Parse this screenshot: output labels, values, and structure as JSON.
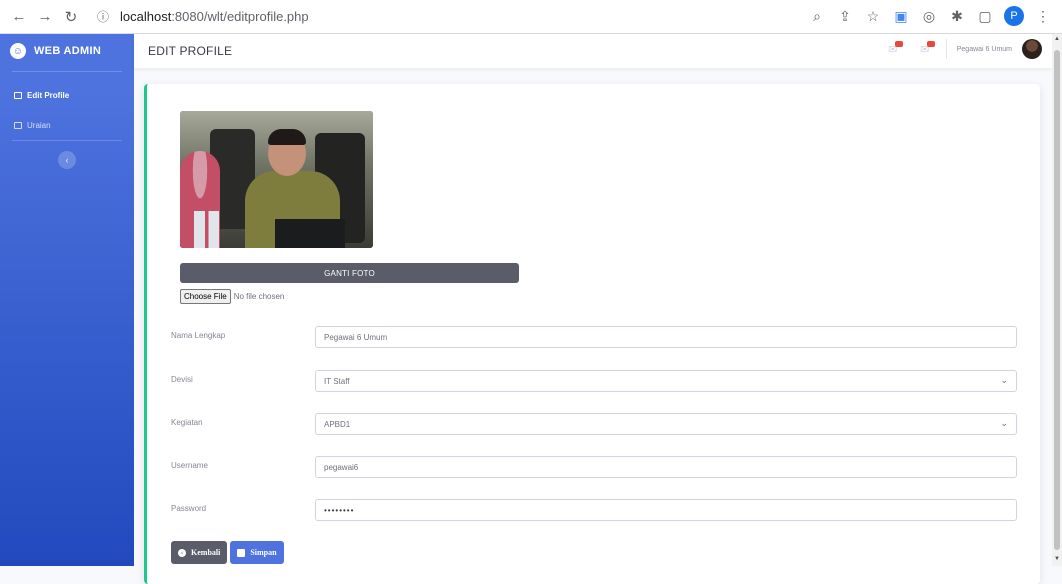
{
  "browser": {
    "url_host": "localhost",
    "url_path": ":8080/wlt/editprofile.php",
    "profile_initial": "P"
  },
  "sidebar": {
    "brand": "WEB ADMIN",
    "items": [
      {
        "label": "Edit Profile",
        "active": true
      },
      {
        "label": "Uraian",
        "active": false
      }
    ],
    "toggle_icon": "chevron-left-icon"
  },
  "topbar": {
    "title": "EDIT PROFILE",
    "user_name": "Pegawai 6 Umum"
  },
  "profile": {
    "change_photo_label": "GANTI FOTO",
    "choose_file_label": "Choose File",
    "file_status": "No file chosen",
    "fields": {
      "nama": {
        "label": "Nama Lengkap",
        "value": "Pegawai 6 Umum"
      },
      "devisi": {
        "label": "Devisi",
        "value": "IT Staff"
      },
      "kegiatan": {
        "label": "Kegiatan",
        "value": "APBD1"
      },
      "username": {
        "label": "Username",
        "value": "pegawai6"
      },
      "password": {
        "label": "Password",
        "value": "••••••••"
      }
    },
    "back_label": "Kembali",
    "save_label": "Simpan"
  },
  "colors": {
    "sidebar_top": "#4e73df",
    "sidebar_bottom": "#224abe",
    "card_accent": "#1cc88a",
    "alert": "#e74a3b"
  }
}
